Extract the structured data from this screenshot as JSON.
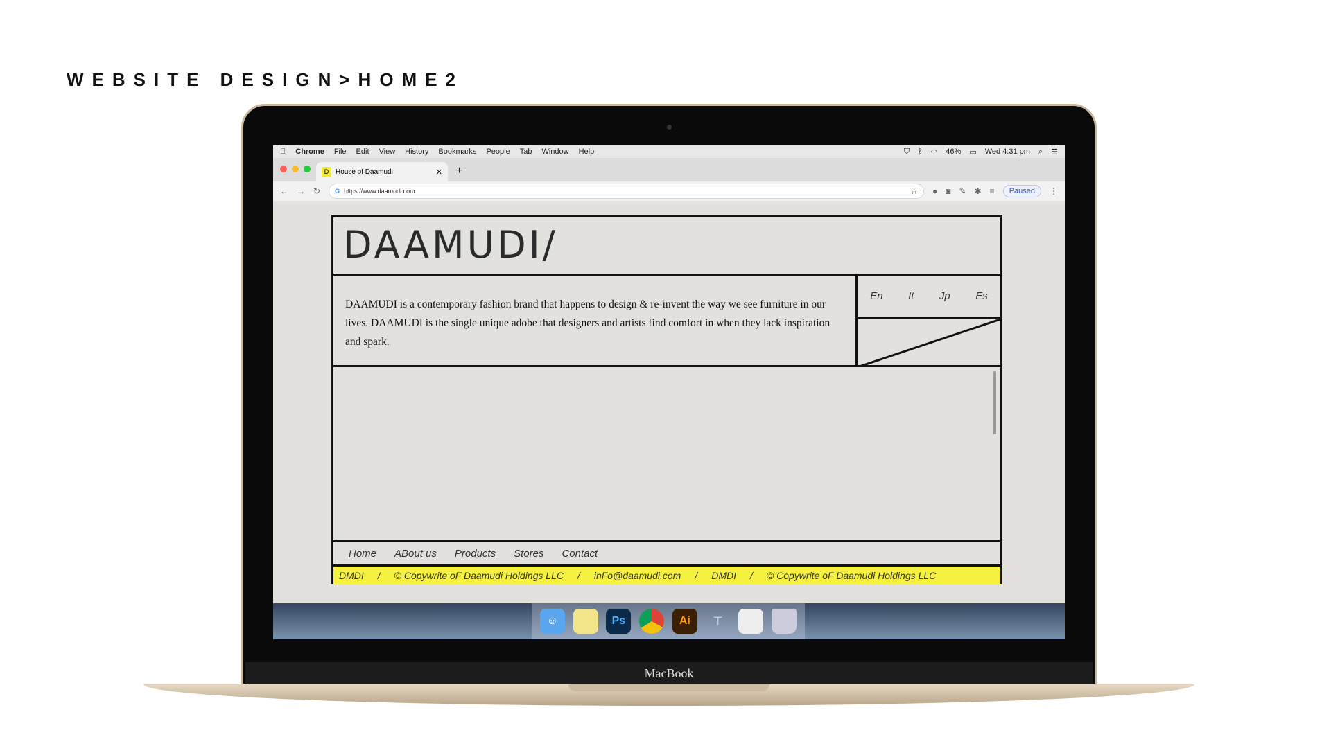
{
  "slide_title": "WEBSITE DESIGN>HOME2",
  "laptop_label": "MacBook",
  "menubar": {
    "items": [
      "Chrome",
      "File",
      "Edit",
      "View",
      "History",
      "Bookmarks",
      "People",
      "Tab",
      "Window",
      "Help"
    ],
    "battery": "46%",
    "clock": "Wed 4:31 pm"
  },
  "browser": {
    "tab_title": "House of Daamudi",
    "url": "https://www.daamudi.com",
    "profile_status": "Paused"
  },
  "site": {
    "logo": "DAAMUDI/",
    "description": "DAAMUDI is a contemporary fashion brand that happens to design & re-invent the way we see  furniture in our lives. DAAMUDI is the single unique adobe that designers and artists find comfort in when they lack inspiration and spark.",
    "languages": [
      "En",
      "It",
      "Jp",
      "Es"
    ],
    "nav": [
      "Home",
      "ABout us",
      "Products",
      "Stores",
      "Contact"
    ],
    "footer": [
      "DMDI",
      "/",
      "© Copywrite oF Daamudi Holdings LLC",
      "/",
      "inFo@daamudi.com",
      "/",
      "DMDI",
      "/",
      "© Copywrite oF Daamudi Holdings LLC"
    ],
    "accent": "#f6f03e"
  },
  "dock": {
    "apps": [
      "Finder",
      "Stickies",
      "Ps",
      "Chrome",
      "Ai",
      "Keynote",
      "Preview",
      "Trash"
    ]
  }
}
